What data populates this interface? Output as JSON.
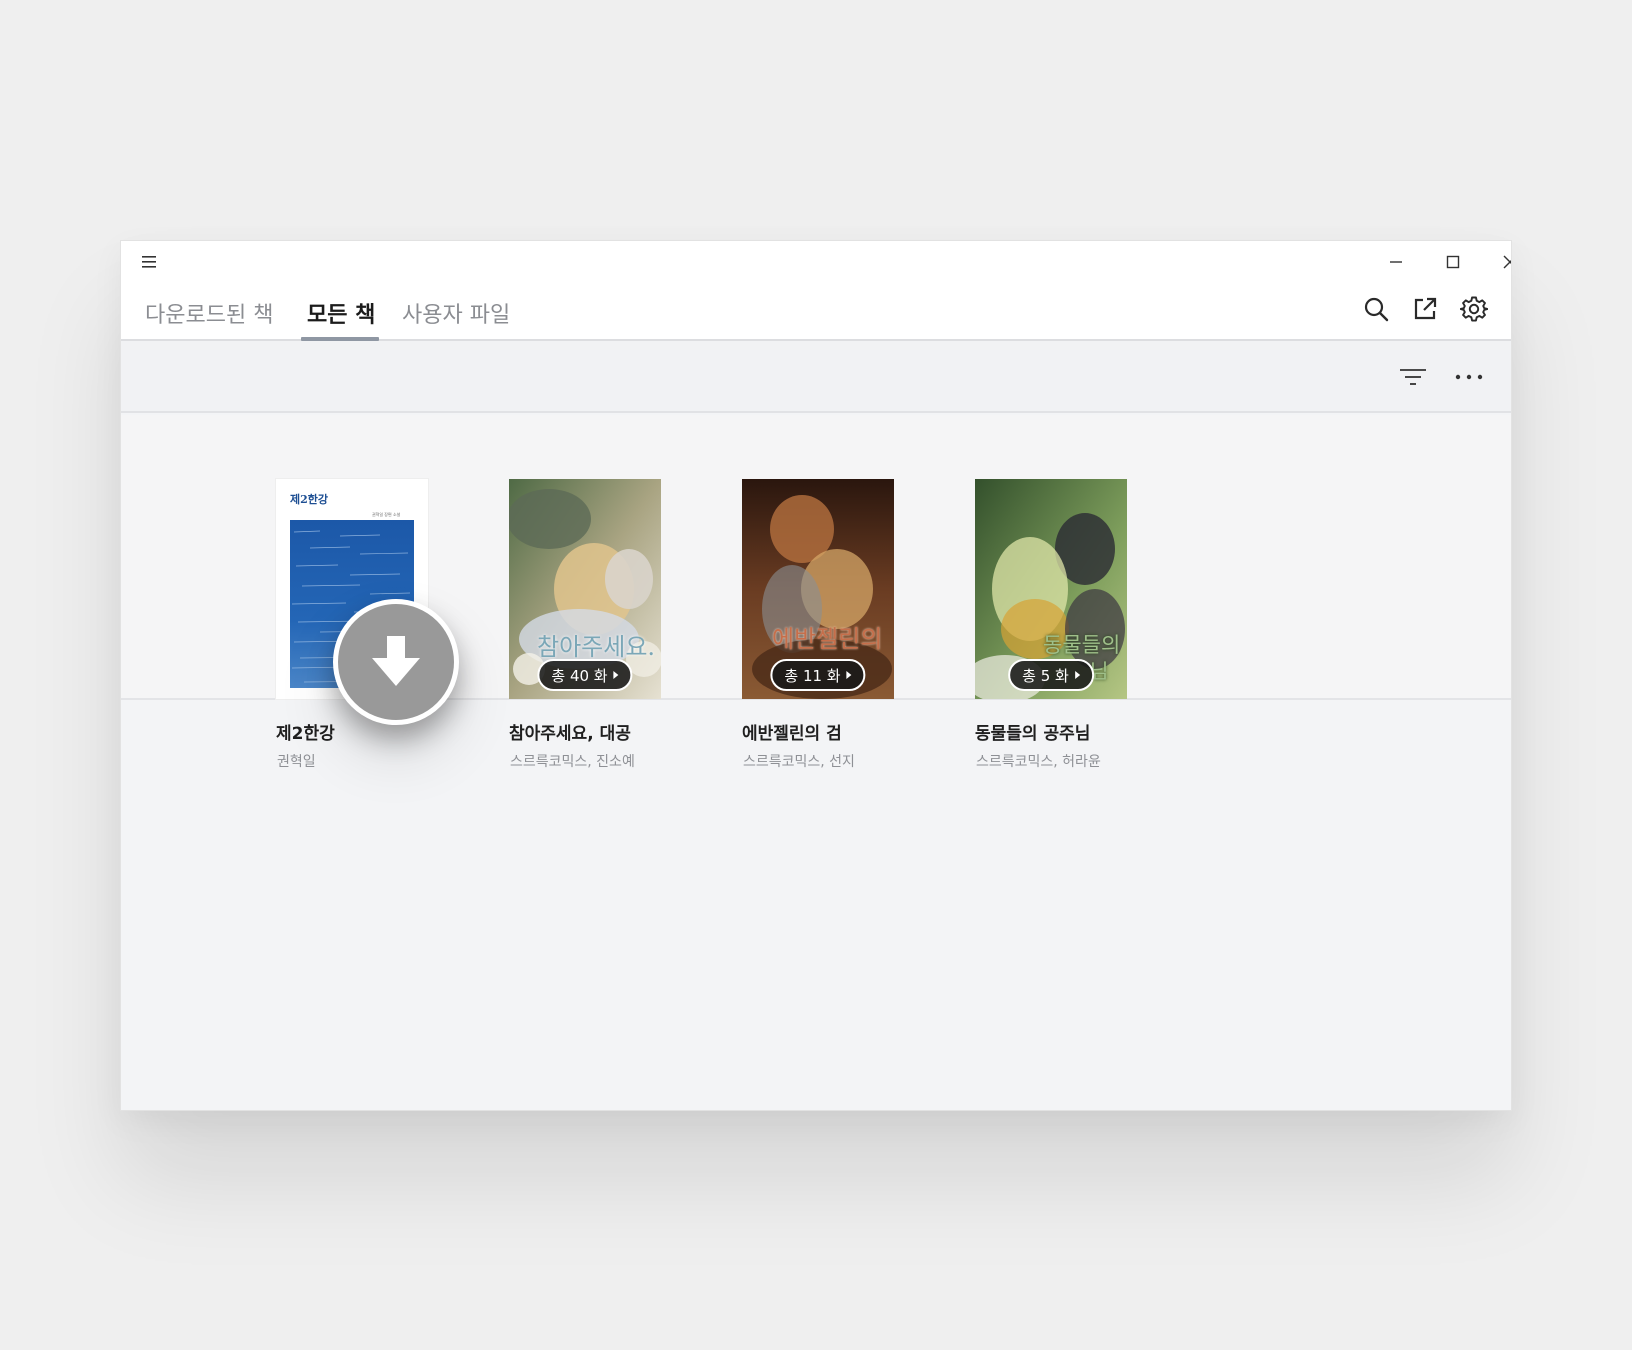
{
  "window": {
    "menu_icon": "hamburger-menu-icon",
    "controls": [
      "minimize-icon",
      "maximize-icon",
      "close-icon"
    ]
  },
  "tabs": [
    {
      "label": "다운로드된 책",
      "active": false
    },
    {
      "label": "모든 책",
      "active": true
    },
    {
      "label": "사용자 파일",
      "active": false
    }
  ],
  "tools": [
    "search-icon",
    "external-link-icon",
    "gear-icon"
  ],
  "toolbar": {
    "icons": [
      "filter-icon",
      "more-horizontal-icon"
    ]
  },
  "books": [
    {
      "title": "제2한강",
      "author": "권혁일",
      "cover_title": "제2한강",
      "cover_subtitle": "권혁일 장편 소설",
      "cover_colors": [
        "#ffffff",
        "#1f5fb0"
      ]
    },
    {
      "title": "참아주세요, 대공",
      "author": "스르륵코믹스, 진소예",
      "cover_text": "참아주세요.",
      "episodes": "총 40 화",
      "cover_colors": [
        "#6f8a5e",
        "#c9b48a",
        "#e7e2d6"
      ]
    },
    {
      "title": "에반젤린의 검",
      "author": "스르륵코믹스, 선지",
      "cover_text": "에반젤린의",
      "episodes": "총 11 화",
      "cover_colors": [
        "#3a2216",
        "#7a4a2a",
        "#c8924f"
      ]
    },
    {
      "title": "동물들의 공주님",
      "author": "스르륵코믹스, 허라윤",
      "cover_text": "동물들의",
      "cover_text2": "님",
      "episodes": "총 5 화",
      "cover_colors": [
        "#3f5e35",
        "#8fae6a",
        "#d8cf8a"
      ]
    }
  ],
  "fab": {
    "icon": "download-arrow-icon"
  }
}
